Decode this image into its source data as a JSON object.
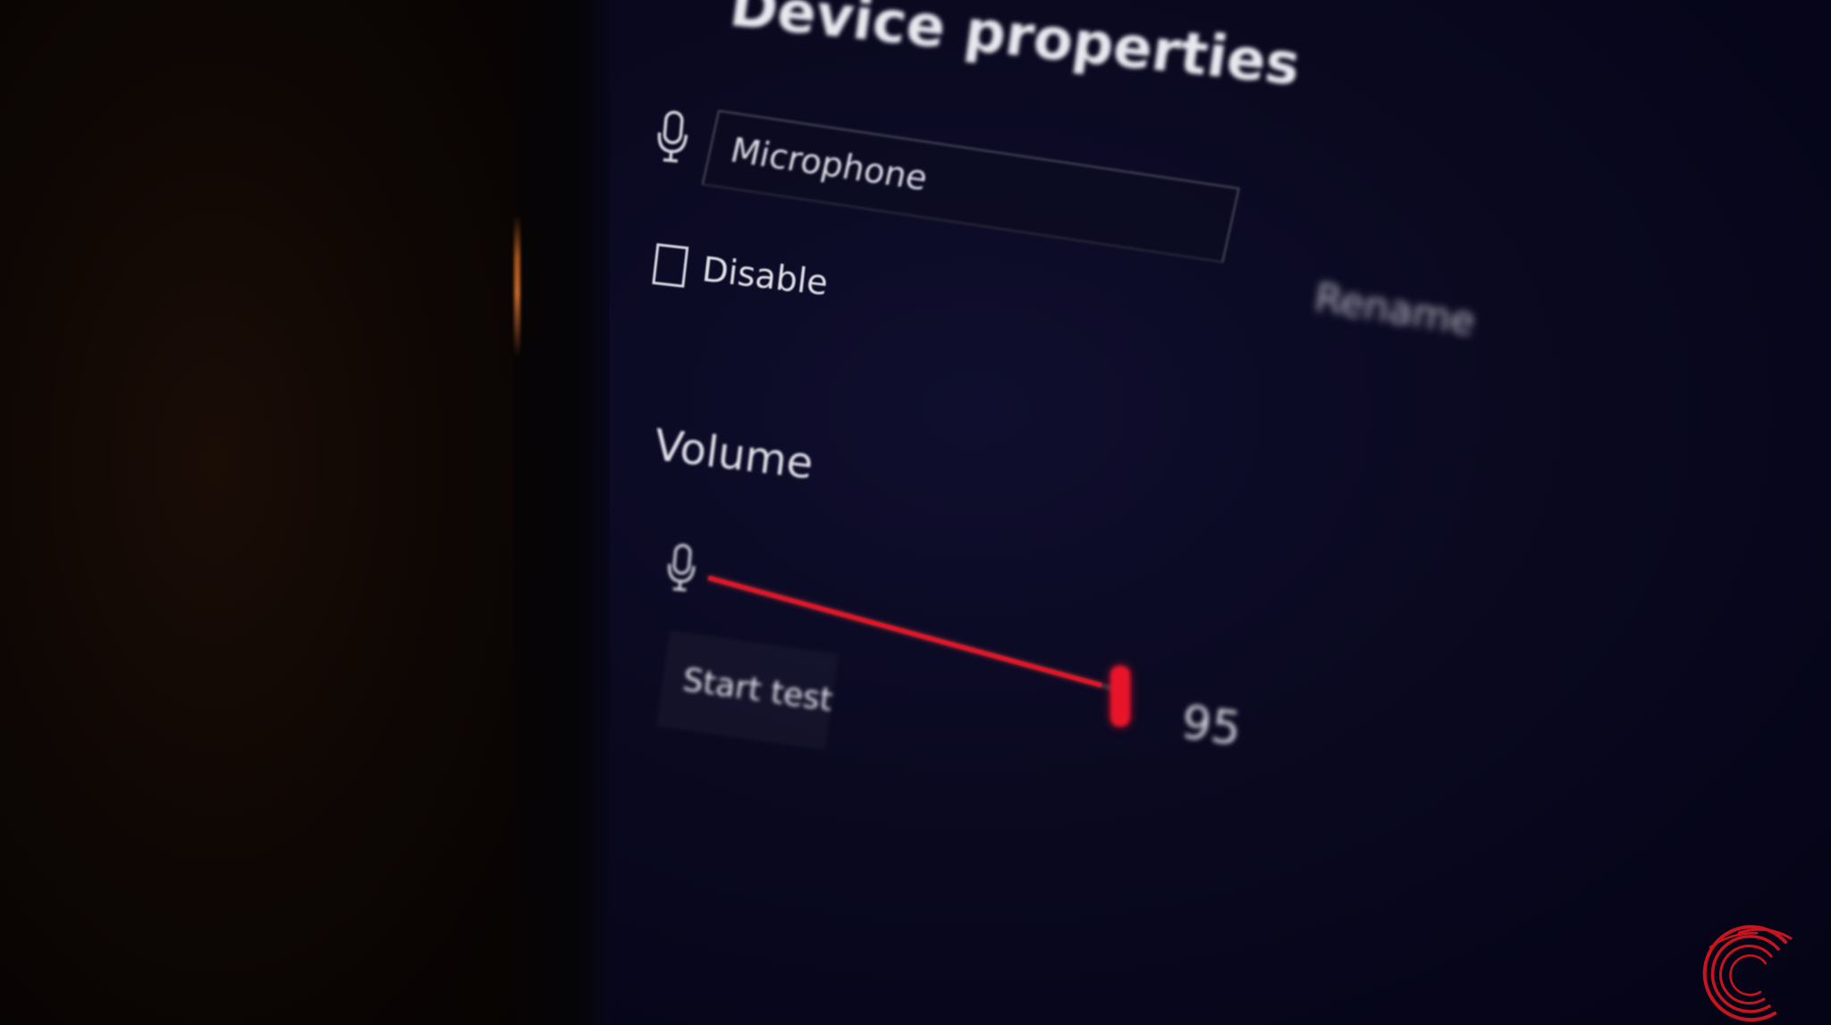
{
  "window": {
    "title": "Device properties"
  },
  "device": {
    "icon": "microphone-icon",
    "name_value": "Microphone",
    "rename_label": "Rename",
    "disable_label": "Disable",
    "disable_checked": false
  },
  "volume": {
    "heading": "Volume",
    "icon": "microphone-icon",
    "value": 95,
    "value_label": "95",
    "fraction": 0.95,
    "start_test_label": "Start test"
  },
  "colors": {
    "accent": "#e01525",
    "screen_background": "#0a0920",
    "text": "#e6e6ec"
  },
  "watermark": {
    "icon": "brand-logo-icon",
    "color": "#c8141e"
  }
}
